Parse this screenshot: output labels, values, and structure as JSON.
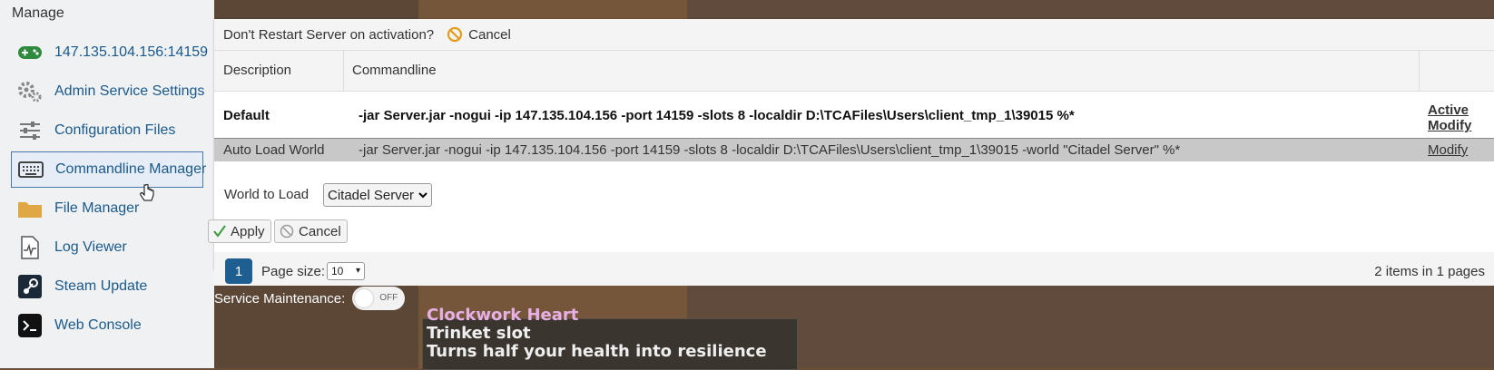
{
  "sidebar": {
    "title": "Manage",
    "items": [
      {
        "label": "147.135.104.156:14159",
        "icon": "gamepad-icon"
      },
      {
        "label": "Admin Service Settings",
        "icon": "gears-icon"
      },
      {
        "label": "Configuration Files",
        "icon": "sliders-icon"
      },
      {
        "label": "Commandline Manager",
        "icon": "keyboard-icon",
        "active": true
      },
      {
        "label": "File Manager",
        "icon": "folder-icon"
      },
      {
        "label": "Log Viewer",
        "icon": "log-file-icon"
      },
      {
        "label": "Steam Update",
        "icon": "steam-icon"
      },
      {
        "label": "Web Console",
        "icon": "terminal-icon"
      }
    ]
  },
  "toolbar": {
    "prompt": "Don't Restart Server on activation?",
    "cancel_label": "Cancel"
  },
  "grid": {
    "columns": [
      "Description",
      "Commandline"
    ],
    "rows": [
      {
        "description": "Default",
        "commandline": "-jar Server.jar -nogui -ip 147.135.104.156 -port 14159 -slots 8 -localdir D:\\TCAFiles\\Users\\client_tmp_1\\39015 %*",
        "actions": [
          "Active",
          "Modify"
        ]
      },
      {
        "description": "Auto Load World",
        "commandline": "-jar Server.jar -nogui -ip 147.135.104.156 -port 14159 -slots 8 -localdir D:\\TCAFiles\\Users\\client_tmp_1\\39015 -world \"Citadel Server\" %*",
        "actions": [
          "Modify"
        ]
      }
    ]
  },
  "editor": {
    "world_label": "World to Load",
    "world_value": "Citadel Server",
    "apply_label": "Apply",
    "cancel_label": "Cancel"
  },
  "pager": {
    "current_page": "1",
    "page_size_label": "Page size:",
    "page_size_value": "10",
    "items_info": "2 items in 1 pages"
  },
  "maintenance": {
    "label": "Service Maintenance:",
    "toggle_text": "OFF"
  },
  "game": {
    "item_name": "Clockwork Heart",
    "slot": "Trinket slot",
    "desc": "Turns half your health into resilience"
  },
  "colors": {
    "link": "#1a5a8c",
    "page_active": "#1e5e91",
    "selected_row": "#c8c8c8"
  }
}
